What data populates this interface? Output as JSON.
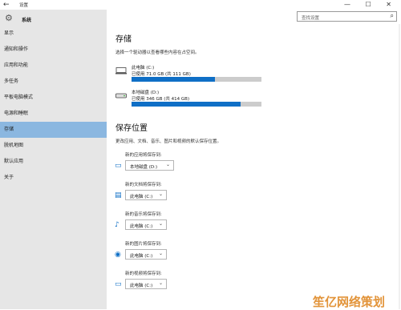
{
  "window": {
    "back_glyph": "←",
    "title": "设置",
    "controls": "— ☐ ✕"
  },
  "sidebar": {
    "home_label": "系统",
    "items": [
      {
        "label": "显示"
      },
      {
        "label": "通知和操作"
      },
      {
        "label": "应用和功能"
      },
      {
        "label": "多任务"
      },
      {
        "label": "平板电脑模式"
      },
      {
        "label": "电源和睡眠"
      },
      {
        "label": "存储"
      },
      {
        "label": "脱机地图"
      },
      {
        "label": "默认应用"
      },
      {
        "label": "关于"
      }
    ],
    "active_index": 6
  },
  "search": {
    "placeholder": "查找设置"
  },
  "storage": {
    "title": "存储",
    "description": "选择一个驱动器以查看哪些内容在占空间。",
    "drives": [
      {
        "name": "此电脑 (C:)",
        "usage": "已使用 71.0 GB (共 111 GB)",
        "used_fraction": 0.64
      },
      {
        "name": "本地磁盘 (D:)",
        "usage": "已使用 346 GB (共 414 GB)",
        "used_fraction": 0.84
      }
    ]
  },
  "save_locations": {
    "title": "保存位置",
    "description": "更改应用、文档、音乐、图片和视频的默认保存位置。",
    "items": [
      {
        "label": "新的应用将保存到:",
        "value": "本地磁盘 (D:)",
        "icon": "monitor-icon"
      },
      {
        "label": "新的文档将保存到:",
        "value": "此电脑 (C:)",
        "icon": "document-icon"
      },
      {
        "label": "新的音乐将保存到:",
        "value": "此电脑 (C:)",
        "icon": "music-icon"
      },
      {
        "label": "新的图片将保存到:",
        "value": "此电脑 (C:)",
        "icon": "picture-icon"
      },
      {
        "label": "新的视频将保存到:",
        "value": "此电脑 (C:)",
        "icon": "video-icon"
      }
    ]
  },
  "watermark": "笙亿网络策划",
  "colors": {
    "accent": "#0f6fc6",
    "active_nav": "#8bb7e0",
    "sidebar_bg": "#e6e6e6",
    "bar_bg": "#cccccc"
  }
}
